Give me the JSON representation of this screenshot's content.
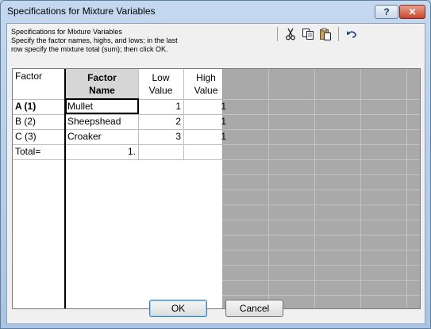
{
  "window": {
    "title": "Specifications for Mixture Variables",
    "help_label": "?",
    "close_label": "✕"
  },
  "instructions": {
    "line1": "Specifications for Mixture Variables",
    "line2": "Specify the factor names, highs, and lows; in the last",
    "line3": "row specify the mixture total (sum); then click OK."
  },
  "toolbar": {
    "icons": [
      "scissors-icon",
      "copy-icon",
      "paste-icon",
      "undo-icon"
    ]
  },
  "table": {
    "corner_label": "Factor",
    "columns": {
      "name": "Factor\nName",
      "low": "Low\nValue",
      "high": "High\nValue"
    },
    "rows": [
      {
        "label": "A  (1)",
        "name": "Mullet",
        "low": "1",
        "high": "1"
      },
      {
        "label": "B  (2)",
        "name": "Sheepshead",
        "low": "2",
        "high": "1"
      },
      {
        "label": "C  (3)",
        "name": "Croaker",
        "low": "3",
        "high": "1"
      }
    ],
    "total": {
      "label": "Total=",
      "value": "1."
    }
  },
  "buttons": {
    "ok": "OK",
    "cancel": "Cancel"
  }
}
